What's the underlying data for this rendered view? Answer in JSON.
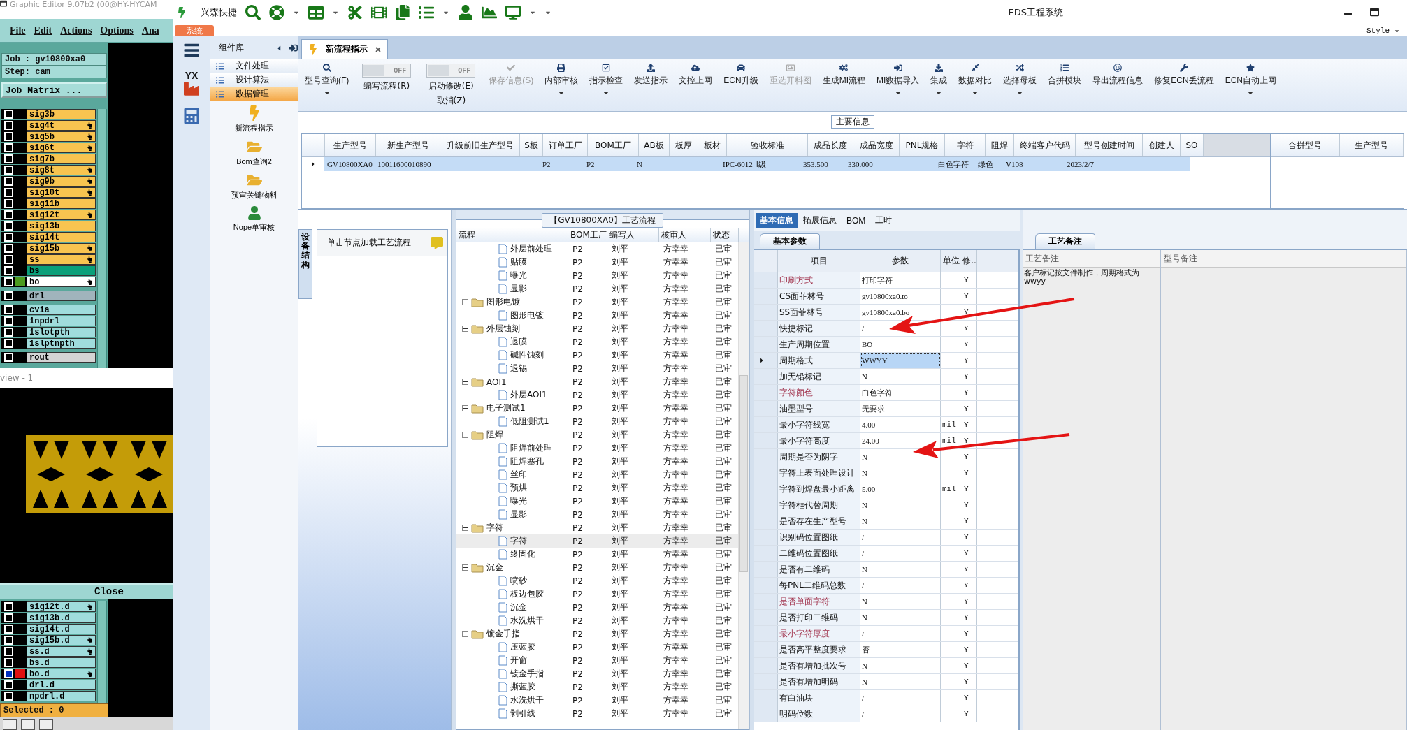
{
  "editor": {
    "title": "Graphic Editor 9.07b2 (00@HY-HYCAM",
    "menu": [
      "File",
      "Edit",
      "Actions",
      "Options",
      "Ana"
    ],
    "job": "Job : gv10800xa0",
    "step": "Step: cam",
    "job_matrix": "Job Matrix ...",
    "layer_groups": [
      {
        "layers": [
          {
            "name": "sig3b",
            "color": "#f8c450",
            "flagged": false,
            "checked": false
          },
          {
            "name": "sig4t",
            "color": "#f8c450",
            "flagged": true,
            "checked": false
          },
          {
            "name": "sig5b",
            "color": "#f8c450",
            "flagged": true,
            "checked": false
          },
          {
            "name": "sig6t",
            "color": "#f8c450",
            "flagged": true,
            "checked": false
          },
          {
            "name": "sig7b",
            "color": "#f8c450",
            "flagged": false,
            "checked": false
          },
          {
            "name": "sig8t",
            "color": "#f8c450",
            "flagged": true,
            "checked": false
          },
          {
            "name": "sig9b",
            "color": "#f8c450",
            "flagged": true,
            "checked": false
          },
          {
            "name": "sig10t",
            "color": "#f8c450",
            "flagged": true,
            "checked": false
          },
          {
            "name": "sig11b",
            "color": "#f8c450",
            "flagged": false,
            "checked": false
          },
          {
            "name": "sig12t",
            "color": "#f8c450",
            "flagged": true,
            "checked": false
          },
          {
            "name": "sig13b",
            "color": "#f8c450",
            "flagged": false,
            "checked": false
          },
          {
            "name": "sig14t",
            "color": "#f8c450",
            "flagged": false,
            "checked": false
          },
          {
            "name": "sig15b",
            "color": "#f8c450",
            "flagged": true,
            "checked": false
          },
          {
            "name": "ss",
            "color": "#f8c450",
            "flagged": true,
            "checked": false
          },
          {
            "name": "bs",
            "color": "#0aa07a",
            "flagged": false,
            "checked": false
          },
          {
            "name": "bo",
            "color": "#ffffff",
            "flagged": true,
            "checked": false,
            "swatch": {
              "color": "#4c9a1e"
            }
          }
        ]
      },
      {
        "layers": [
          {
            "name": "drl",
            "color": "#a0b4bc",
            "flagged": false,
            "checked": false
          }
        ]
      },
      {
        "layers": [
          {
            "name": "cvia",
            "color": "#a0dcdc",
            "flagged": false,
            "checked": false
          },
          {
            "name": "1npdrl",
            "color": "#a0dcdc",
            "flagged": false,
            "checked": false
          },
          {
            "name": "1slotpth",
            "color": "#a0dcdc",
            "flagged": false,
            "checked": false
          },
          {
            "name": "1slptnpth",
            "color": "#a0dcdc",
            "flagged": false,
            "checked": false
          }
        ]
      },
      {
        "layers": [
          {
            "name": "rout",
            "color": "#d4d4d4",
            "flagged": false,
            "checked": false
          }
        ]
      }
    ],
    "view_title": "view - 1",
    "close": "Close",
    "lower_layers": [
      {
        "name": "sig12t.d",
        "color": "#a0dcdc",
        "flagged": true,
        "checked": false
      },
      {
        "name": "sig13b.d",
        "color": "#a0dcdc",
        "flagged": false,
        "checked": false
      },
      {
        "name": "sig14t.d",
        "color": "#a0dcdc",
        "flagged": false,
        "checked": false
      },
      {
        "name": "sig15b.d",
        "color": "#a0dcdc",
        "flagged": true,
        "checked": false
      },
      {
        "name": "ss.d",
        "color": "#a0dcdc",
        "flagged": true,
        "checked": false
      },
      {
        "name": "bs.d",
        "color": "#a0dcdc",
        "flagged": false,
        "checked": false
      },
      {
        "name": "bo.d",
        "color": "#a0dcdc",
        "flagged": true,
        "checked": true,
        "swatch": {
          "color": "#e01010"
        }
      },
      {
        "name": "drl.d",
        "color": "#a0dcdc",
        "flagged": false,
        "checked": false
      },
      {
        "name": "npdrl.d",
        "color": "#a0dcdc",
        "flagged": false,
        "checked": false
      }
    ],
    "selected_count": "Selected : 0"
  },
  "app": {
    "quick_label": "兴森快捷",
    "title": "EDS工程系统",
    "system_tab": "系统",
    "style_menu": "Style",
    "rail_logo": "YX",
    "sidebar": {
      "header": "组件库",
      "items": [
        {
          "label": "文件处理",
          "selected": false
        },
        {
          "label": "设计算法",
          "selected": false
        },
        {
          "label": "数据管理",
          "selected": true
        }
      ],
      "tools": [
        {
          "kind": "lightning",
          "label": "新流程指示"
        },
        {
          "kind": "folder",
          "label": "Bom查询2"
        },
        {
          "kind": "folder",
          "label": "预审关键物料"
        },
        {
          "kind": "user",
          "label": "Nope单审核"
        }
      ]
    },
    "doc_tab": {
      "label": "新流程指示",
      "selected": true
    },
    "ribbon": [
      {
        "kind": "button",
        "label": "型号查询(F)",
        "dropdown": true,
        "disabled": false
      },
      {
        "kind": "toggle",
        "label": "编写流程(R)",
        "state_text": "OFF",
        "on": false
      },
      {
        "kind": "toggle",
        "label": "启动修改(E)",
        "sublabel": "取消(Z)",
        "state_text": "OFF",
        "on": false
      },
      {
        "kind": "button",
        "label": "保存信息(S)",
        "dropdown": false,
        "disabled": true
      },
      {
        "kind": "button",
        "label": "内部审核",
        "dropdown": true,
        "disabled": false
      },
      {
        "kind": "button",
        "label": "指示检查",
        "dropdown": true,
        "disabled": false
      },
      {
        "kind": "button",
        "label": "发送指示",
        "dropdown": false,
        "disabled": false
      },
      {
        "kind": "button",
        "label": "文控上网",
        "dropdown": false,
        "disabled": false
      },
      {
        "kind": "button",
        "label": "ECN升级",
        "dropdown": false,
        "disabled": false
      },
      {
        "kind": "button",
        "label": "重选开料图",
        "dropdown": false,
        "disabled": true
      },
      {
        "kind": "button",
        "label": "生成MI流程",
        "dropdown": false,
        "disabled": false
      },
      {
        "kind": "button",
        "label": "MI数据导入",
        "dropdown": true,
        "disabled": false
      },
      {
        "kind": "button",
        "label": "集成",
        "dropdown": true,
        "disabled": false
      },
      {
        "kind": "button",
        "label": "数据对比",
        "dropdown": true,
        "disabled": false
      },
      {
        "kind": "button",
        "label": "选择母板",
        "dropdown": true,
        "disabled": false
      },
      {
        "kind": "button",
        "label": "合拼模块",
        "dropdown": false,
        "disabled": false
      },
      {
        "kind": "button",
        "label": "导出流程信息",
        "dropdown": false,
        "disabled": false
      },
      {
        "kind": "button",
        "label": "修复ECN丢流程",
        "dropdown": false,
        "disabled": false
      },
      {
        "kind": "button",
        "label": "ECN自动上网",
        "dropdown": true,
        "disabled": false
      }
    ],
    "main_info": {
      "title": "主要信息",
      "columns": [
        "生产型号",
        "新生产型号",
        "升级前旧生产型号",
        "S板",
        "订单工厂",
        "BOM工厂",
        "AB板",
        "板厚",
        "板材",
        "验收标准",
        "成品长度",
        "成品宽度",
        "PNL规格",
        "字符",
        "阻焊",
        "终端客户代码",
        "型号创建时间",
        "创建人",
        "SO"
      ],
      "rows": [
        {
          "selected": true,
          "cells": [
            "GV10800XA0",
            "10011600010890",
            null,
            null,
            "P2",
            "P2",
            "N",
            null,
            null,
            "IPC-6012 Ⅱ级",
            "353.500",
            "330.000",
            null,
            "白色字符",
            "绿色",
            "V108",
            "2023/2/7",
            null,
            null
          ]
        }
      ],
      "side_columns": [
        "合拼型号",
        "生产型号"
      ]
    },
    "device_nav": {
      "tab": "设备结构",
      "item": "单击节点加载工艺流程"
    },
    "process": {
      "title": "【GV10800XA0】工艺流程",
      "columns": [
        "流程",
        "BOM工厂",
        "编写人",
        "核审人",
        "状态"
      ],
      "nodes": [
        {
          "kind": "hidden",
          "children": [
            {
              "kind": "leaf",
              "name": "外层前处理",
              "bom": "P2",
              "author": "刘平",
              "reviewer": "方幸幸",
              "status": "已审",
              "selected": false
            },
            {
              "kind": "leaf",
              "name": "贴膜",
              "bom": "P2",
              "author": "刘平",
              "reviewer": "方幸幸",
              "status": "已审",
              "selected": false
            },
            {
              "kind": "leaf",
              "name": "曝光",
              "bom": "P2",
              "author": "刘平",
              "reviewer": "方幸幸",
              "status": "已审",
              "selected": false
            },
            {
              "kind": "leaf",
              "name": "显影",
              "bom": "P2",
              "author": "刘平",
              "reviewer": "方幸幸",
              "status": "已审",
              "selected": false
            }
          ]
        },
        {
          "kind": "folder",
          "name": "图形电镀",
          "bom": "P2",
          "author": "刘平",
          "reviewer": "方幸幸",
          "status": "已审",
          "selected": false,
          "expanded": true,
          "children": [
            {
              "kind": "leaf",
              "name": "图形电镀",
              "bom": "P2",
              "author": "刘平",
              "reviewer": "方幸幸",
              "status": "已审",
              "selected": false
            }
          ]
        },
        {
          "kind": "folder",
          "name": "外层蚀刻",
          "bom": "P2",
          "author": "刘平",
          "reviewer": "方幸幸",
          "status": "已审",
          "selected": false,
          "expanded": true,
          "children": [
            {
              "kind": "leaf",
              "name": "退膜",
              "bom": "P2",
              "author": "刘平",
              "reviewer": "方幸幸",
              "status": "已审",
              "selected": false
            },
            {
              "kind": "leaf",
              "name": "碱性蚀刻",
              "bom": "P2",
              "author": "刘平",
              "reviewer": "方幸幸",
              "status": "已审",
              "selected": false
            },
            {
              "kind": "leaf",
              "name": "退锡",
              "bom": "P2",
              "author": "刘平",
              "reviewer": "方幸幸",
              "status": "已审",
              "selected": false
            }
          ]
        },
        {
          "kind": "folder",
          "name": "AOI1",
          "bom": "P2",
          "author": "刘平",
          "reviewer": "方幸幸",
          "status": "已审",
          "selected": false,
          "expanded": true,
          "children": [
            {
              "kind": "leaf",
              "name": "外层AOI1",
              "bom": "P2",
              "author": "刘平",
              "reviewer": "方幸幸",
              "status": "已审",
              "selected": false
            }
          ]
        },
        {
          "kind": "folder",
          "name": "电子测试1",
          "bom": "P2",
          "author": "刘平",
          "reviewer": "方幸幸",
          "status": "已审",
          "selected": false,
          "expanded": true,
          "children": [
            {
              "kind": "leaf",
              "name": "低阻测试1",
              "bom": "P2",
              "author": "刘平",
              "reviewer": "方幸幸",
              "status": "已审",
              "selected": false
            }
          ]
        },
        {
          "kind": "folder",
          "name": "阻焊",
          "bom": "P2",
          "author": "刘平",
          "reviewer": "方幸幸",
          "status": "已审",
          "selected": false,
          "expanded": true,
          "children": [
            {
              "kind": "leaf",
              "name": "阻焊前处理",
              "bom": "P2",
              "author": "刘平",
              "reviewer": "方幸幸",
              "status": "已审",
              "selected": false
            },
            {
              "kind": "leaf",
              "name": "阻焊塞孔",
              "bom": "P2",
              "author": "刘平",
              "reviewer": "方幸幸",
              "status": "已审",
              "selected": false
            },
            {
              "kind": "leaf",
              "name": "丝印",
              "bom": "P2",
              "author": "刘平",
              "reviewer": "方幸幸",
              "status": "已审",
              "selected": false
            },
            {
              "kind": "leaf",
              "name": "预烘",
              "bom": "P2",
              "author": "刘平",
              "reviewer": "方幸幸",
              "status": "已审",
              "selected": false
            },
            {
              "kind": "leaf",
              "name": "曝光",
              "bom": "P2",
              "author": "刘平",
              "reviewer": "方幸幸",
              "status": "已审",
              "selected": false
            },
            {
              "kind": "leaf",
              "name": "显影",
              "bom": "P2",
              "author": "刘平",
              "reviewer": "方幸幸",
              "status": "已审",
              "selected": false
            }
          ]
        },
        {
          "kind": "folder",
          "name": "字符",
          "bom": "P2",
          "author": "刘平",
          "reviewer": "方幸幸",
          "status": "已审",
          "selected": false,
          "expanded": true,
          "children": [
            {
              "kind": "leaf",
              "name": "字符",
              "bom": "P2",
              "author": "刘平",
              "reviewer": "方幸幸",
              "status": "已审",
              "selected": true
            },
            {
              "kind": "leaf",
              "name": "终固化",
              "bom": "P2",
              "author": "刘平",
              "reviewer": "方幸幸",
              "status": "已审",
              "selected": false
            }
          ]
        },
        {
          "kind": "folder",
          "name": "沉金",
          "bom": "P2",
          "author": "刘平",
          "reviewer": "方幸幸",
          "status": "已审",
          "selected": false,
          "expanded": true,
          "children": [
            {
              "kind": "leaf",
              "name": "喷砂",
              "bom": "P2",
              "author": "刘平",
              "reviewer": "方幸幸",
              "status": "已审",
              "selected": false
            },
            {
              "kind": "leaf",
              "name": "板边包胶",
              "bom": "P2",
              "author": "刘平",
              "reviewer": "方幸幸",
              "status": "已审",
              "selected": false
            },
            {
              "kind": "leaf",
              "name": "沉金",
              "bom": "P2",
              "author": "刘平",
              "reviewer": "方幸幸",
              "status": "已审",
              "selected": false
            },
            {
              "kind": "leaf",
              "name": "水洗烘干",
              "bom": "P2",
              "author": "刘平",
              "reviewer": "方幸幸",
              "status": "已审",
              "selected": false
            }
          ]
        },
        {
          "kind": "folder",
          "name": "镀金手指",
          "bom": "P2",
          "author": "刘平",
          "reviewer": "方幸幸",
          "status": "已审",
          "selected": false,
          "expanded": true,
          "children": [
            {
              "kind": "leaf",
              "name": "压蓝胶",
              "bom": "P2",
              "author": "刘平",
              "reviewer": "方幸幸",
              "status": "已审",
              "selected": false
            },
            {
              "kind": "leaf",
              "name": "开窗",
              "bom": "P2",
              "author": "刘平",
              "reviewer": "方幸幸",
              "status": "已审",
              "selected": false
            },
            {
              "kind": "leaf",
              "name": "镀金手指",
              "bom": "P2",
              "author": "刘平",
              "reviewer": "方幸幸",
              "status": "已审",
              "selected": false
            },
            {
              "kind": "leaf",
              "name": "撕蓝胶",
              "bom": "P2",
              "author": "刘平",
              "reviewer": "方幸幸",
              "status": "已审",
              "selected": false
            },
            {
              "kind": "leaf",
              "name": "水洗烘干",
              "bom": "P2",
              "author": "刘平",
              "reviewer": "方幸幸",
              "status": "已审",
              "selected": false
            },
            {
              "kind": "leaf",
              "name": "剥引线",
              "bom": "P2",
              "author": "刘平",
              "reviewer": "方幸幸",
              "status": "已审",
              "selected": false
            }
          ]
        }
      ]
    },
    "properties": {
      "tabs": [
        {
          "label": "基本信息",
          "selected": true
        },
        {
          "label": "拓展信息",
          "selected": false
        },
        {
          "label": "BOM",
          "selected": false
        },
        {
          "label": "工时",
          "selected": false
        }
      ],
      "section": "基本参数",
      "columns": [
        "项目",
        "参数",
        "单位",
        "修.."
      ],
      "rows": [
        {
          "label": "印刷方式",
          "value": "打印字符",
          "flag": "Y",
          "highlighted": true,
          "selected": false
        },
        {
          "label": "CS面菲林号",
          "value": "gv10800xa0.to",
          "flag": "Y",
          "highlighted": false,
          "selected": false
        },
        {
          "label": "SS面菲林号",
          "value": "gv10800xa0.bo",
          "flag": "Y",
          "highlighted": false,
          "selected": false
        },
        {
          "label": "快捷标记",
          "value": "/",
          "flag": "Y",
          "highlighted": false,
          "selected": false
        },
        {
          "label": "生产周期位置",
          "value": "BO",
          "flag": "Y",
          "highlighted": false,
          "selected": false
        },
        {
          "label": "周期格式",
          "value": "WWYY",
          "flag": "Y",
          "highlighted": false,
          "selected": true
        },
        {
          "label": "加无铅标记",
          "value": "N",
          "flag": "Y",
          "highlighted": false,
          "selected": false
        },
        {
          "label": "字符颜色",
          "value": "白色字符",
          "flag": "Y",
          "highlighted": true,
          "selected": false
        },
        {
          "label": "油墨型号",
          "value": "无要求",
          "flag": "Y",
          "highlighted": false,
          "selected": false
        },
        {
          "label": "最小字符线宽",
          "value": "4.00",
          "unit": "mil",
          "flag": "Y",
          "highlighted": false,
          "selected": false
        },
        {
          "label": "最小字符高度",
          "value": "24.00",
          "unit": "mil",
          "flag": "Y",
          "highlighted": false,
          "selected": false
        },
        {
          "label": "周期是否为阴字",
          "value": "N",
          "flag": "Y",
          "highlighted": false,
          "selected": false
        },
        {
          "label": "字符上表面处理设计",
          "value": "N",
          "flag": "Y",
          "highlighted": false,
          "selected": false
        },
        {
          "label": "字符到焊盘最小距离",
          "value": "5.00",
          "unit": "mil",
          "flag": "Y",
          "highlighted": false,
          "selected": false
        },
        {
          "label": "字符框代替周期",
          "value": "N",
          "flag": "Y",
          "highlighted": false,
          "selected": false
        },
        {
          "label": "是否存在生产型号",
          "value": "N",
          "flag": "Y",
          "highlighted": false,
          "selected": false
        },
        {
          "label": "识别码位置图纸",
          "value": "/",
          "flag": "Y",
          "highlighted": false,
          "selected": false
        },
        {
          "label": "二维码位置图纸",
          "value": "/",
          "flag": "Y",
          "highlighted": false,
          "selected": false
        },
        {
          "label": "是否有二维码",
          "value": "N",
          "flag": "Y",
          "highlighted": false,
          "selected": false
        },
        {
          "label": "每PNL二维码总数",
          "value": "/",
          "flag": "Y",
          "highlighted": false,
          "selected": false
        },
        {
          "label": "是否单面字符",
          "value": "N",
          "flag": "Y",
          "highlighted": true,
          "selected": false
        },
        {
          "label": "是否打印二维码",
          "value": "N",
          "flag": "Y",
          "highlighted": false,
          "selected": false
        },
        {
          "label": "最小字符厚度",
          "value": "/",
          "flag": "Y",
          "highlighted": true,
          "selected": false
        },
        {
          "label": "是否高平整度要求",
          "value": "否",
          "flag": "Y",
          "highlighted": false,
          "selected": false
        },
        {
          "label": "是否有增加批次号",
          "value": "N",
          "flag": "Y",
          "highlighted": false,
          "selected": false
        },
        {
          "label": "是否有增加明码",
          "value": "N",
          "flag": "Y",
          "highlighted": false,
          "selected": false
        },
        {
          "label": "有白油块",
          "value": "/",
          "flag": "Y",
          "highlighted": false,
          "selected": false
        },
        {
          "label": "明码位数",
          "value": "/",
          "flag": "Y",
          "highlighted": false,
          "selected": false
        }
      ]
    },
    "notes": {
      "tab": "工艺备注",
      "columns": [
        "工艺备注",
        "型号备注"
      ],
      "text": "客户标记按文件制作，周期格式为wwyy"
    }
  }
}
